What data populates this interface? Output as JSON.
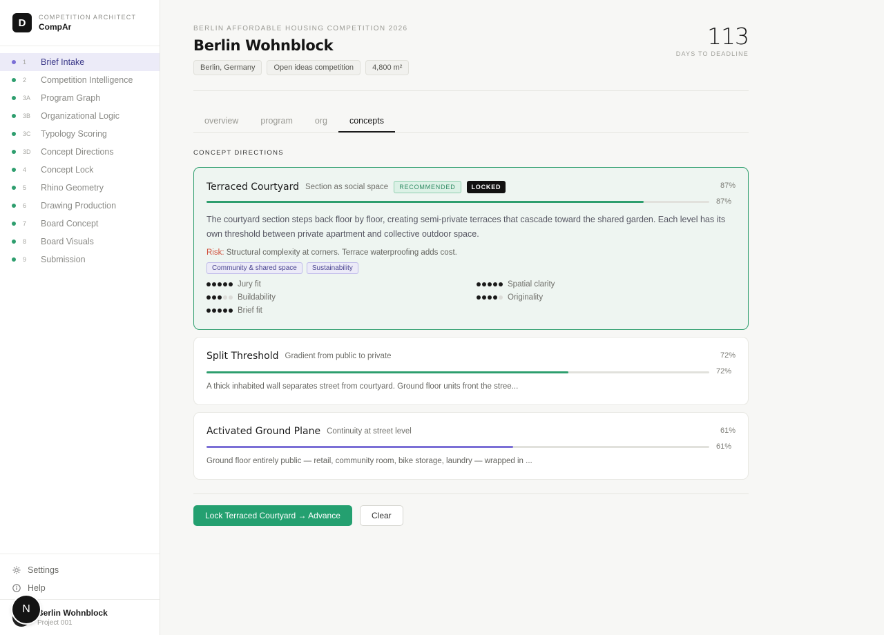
{
  "brand": {
    "kicker": "COMPETITION ARCHITECT",
    "name": "CompAr",
    "logo_letter": "D"
  },
  "nav": [
    {
      "num": "1",
      "label": "Brief Intake",
      "active": true
    },
    {
      "num": "2",
      "label": "Competition Intelligence"
    },
    {
      "num": "3A",
      "label": "Program Graph"
    },
    {
      "num": "3B",
      "label": "Organizational Logic"
    },
    {
      "num": "3C",
      "label": "Typology Scoring"
    },
    {
      "num": "3D",
      "label": "Concept Directions"
    },
    {
      "num": "4",
      "label": "Concept Lock"
    },
    {
      "num": "5",
      "label": "Rhino Geometry"
    },
    {
      "num": "6",
      "label": "Drawing Production"
    },
    {
      "num": "7",
      "label": "Board Concept"
    },
    {
      "num": "8",
      "label": "Board Visuals"
    },
    {
      "num": "9",
      "label": "Submission"
    }
  ],
  "side_links": {
    "settings": "Settings",
    "help": "Help"
  },
  "project": {
    "name": "Berlin Wohnblock",
    "sub": "Project 001",
    "badge_letter": "N"
  },
  "header": {
    "kicker": "BERLIN AFFORDABLE HOUSING COMPETITION 2026",
    "title": "Berlin Wohnblock",
    "chips": [
      "Berlin, Germany",
      "Open ideas competition",
      "4,800 m²"
    ],
    "deadline_num": "113",
    "deadline_label": "DAYS TO DEADLINE"
  },
  "tabs": [
    {
      "label": "overview"
    },
    {
      "label": "program"
    },
    {
      "label": "org"
    },
    {
      "label": "concepts",
      "active": true
    }
  ],
  "section_label": "CONCEPT DIRECTIONS",
  "concepts": [
    {
      "title": "Terraced Courtyard",
      "subtitle": "Section as social space",
      "badge_recommended": "RECOMMENDED",
      "badge_locked": "LOCKED",
      "score": 0.87,
      "pct": "87%",
      "bar_color": "#2e9e6e",
      "desc": "The courtyard section steps back floor by floor, creating semi-private terraces that cascade toward the shared garden. Each level has its own threshold between private apartment and collective outdoor space.",
      "risk_label": "Risk:",
      "risk": "Structural complexity at corners. Terrace waterproofing adds cost.",
      "tags": [
        "Community & shared space",
        "Sustainability"
      ],
      "scores": [
        {
          "label": "Jury fit",
          "value": 5
        },
        {
          "label": "Spatial clarity",
          "value": 5
        },
        {
          "label": "Buildability",
          "value": 3
        },
        {
          "label": "Originality",
          "value": 4
        },
        {
          "label": "Brief fit",
          "value": 5
        }
      ]
    },
    {
      "title": "Split Threshold",
      "subtitle": "Gradient from public to private",
      "score": 0.72,
      "pct": "72%",
      "bar_color": "#2e9e6e",
      "desc": "A thick inhabited wall separates street from courtyard. Ground floor units front the stree..."
    },
    {
      "title": "Activated Ground Plane",
      "subtitle": "Continuity at street level",
      "score": 0.61,
      "pct": "61%",
      "bar_color": "#7b6fd6",
      "desc": "Ground floor entirely public — retail, community room, bike storage, laundry — wrapped in ..."
    }
  ],
  "actions": {
    "primary": "Lock Terraced Courtyard → Advance",
    "secondary": "Clear"
  }
}
